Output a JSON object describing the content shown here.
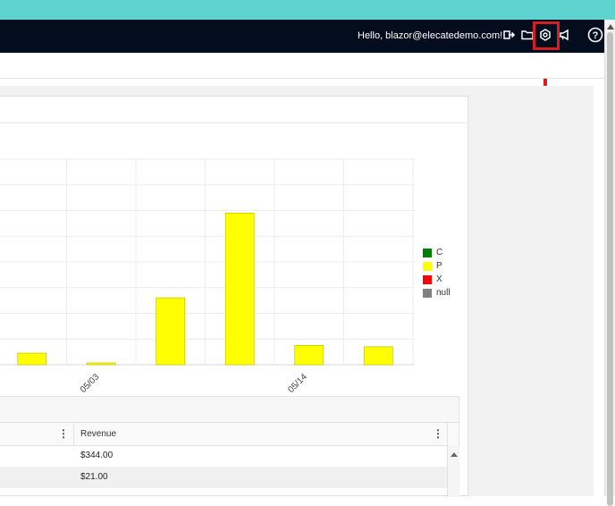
{
  "header": {
    "greeting": "Hello, blazor@elecatedemo.com!",
    "icons": [
      "logout-icon",
      "folder-icon",
      "settings-gear-icon",
      "announcement-icon",
      "help-icon"
    ],
    "highlight_color": "#d42020",
    "bg_color": "#040d1e",
    "top_strip_color": "#5fd3d0"
  },
  "chart_data": {
    "type": "bar",
    "categories": [
      "",
      "05/03",
      "",
      "",
      "05/14",
      "",
      ""
    ],
    "series": [
      {
        "name": "C",
        "color": "#008000",
        "values": [
          0,
          0,
          0,
          0,
          0,
          0,
          0
        ]
      },
      {
        "name": "P",
        "color": "#ffff00",
        "values": [
          0.45,
          0.07,
          2.6,
          5.9,
          0.75,
          0.7,
          0
        ]
      },
      {
        "name": "X",
        "color": "#ff0000",
        "values": [
          0,
          0,
          0,
          0,
          0,
          0,
          0
        ]
      },
      {
        "name": "null",
        "color": "#808080",
        "values": [
          0,
          0,
          0,
          0,
          0,
          0,
          0
        ]
      }
    ],
    "xlabel": "",
    "ylabel": "",
    "ylim": [
      0,
      8
    ],
    "grid": true,
    "legend_position": "right"
  },
  "grid": {
    "columns": [
      {
        "label": "",
        "menu_icon": "kebab-menu-icon"
      },
      {
        "label": "Revenue",
        "menu_icon": "kebab-menu-icon"
      }
    ],
    "rows": [
      {
        "revenue": "$344.00"
      },
      {
        "revenue": "$21.00"
      }
    ]
  }
}
